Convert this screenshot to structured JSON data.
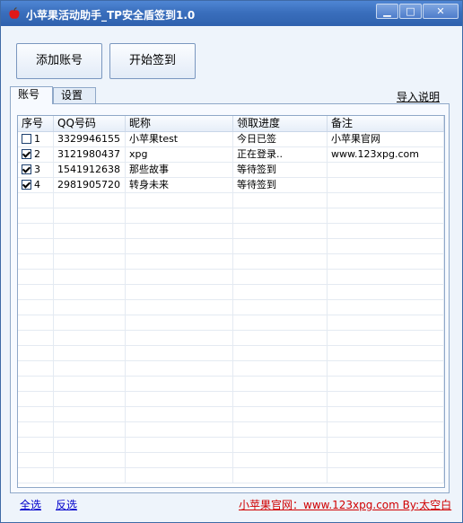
{
  "window": {
    "title": "小苹果活动助手_TP安全盾签到1.0"
  },
  "toolbar": {
    "add_label": "添加账号",
    "start_label": "开始签到"
  },
  "tabs": [
    {
      "label": "账号",
      "active": true
    },
    {
      "label": "设置",
      "active": false
    }
  ],
  "help_link": "导入说明",
  "table": {
    "columns": [
      "序号",
      "QQ号码",
      "昵称",
      "领取进度",
      "备注"
    ],
    "rows": [
      {
        "checked": false,
        "index": "1",
        "qq": "3329946155",
        "nick": "小苹果test",
        "progress": "今日已签",
        "note": "小苹果官网"
      },
      {
        "checked": true,
        "index": "2",
        "qq": "3121980437",
        "nick": "xpg",
        "progress": "正在登录..",
        "note": "www.123xpg.com"
      },
      {
        "checked": true,
        "index": "3",
        "qq": "1541912638",
        "nick": "那些故事",
        "progress": "等待签到",
        "note": ""
      },
      {
        "checked": true,
        "index": "4",
        "qq": "2981905720",
        "nick": "转身未来",
        "progress": "等待签到",
        "note": ""
      }
    ]
  },
  "footer": {
    "select_all": "全选",
    "invert": "反选",
    "site": "小苹果官网：www.123xpg.com  By:太空白"
  },
  "colors": {
    "title_bar": "#3a6fbd",
    "footer_site": "#d00000",
    "link": "#0000cc"
  }
}
